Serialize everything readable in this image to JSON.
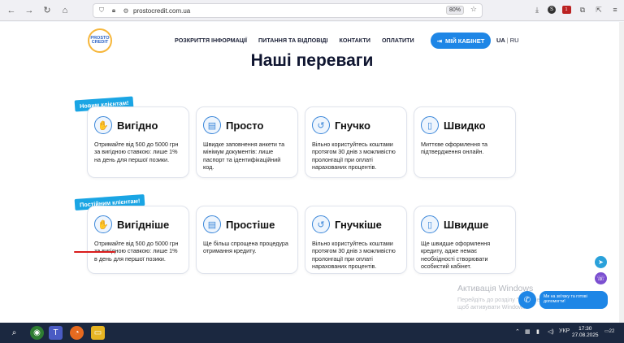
{
  "browser": {
    "url": "prostocredit.com.ua",
    "zoom": "80%",
    "badge_count": "1"
  },
  "header": {
    "logo_line1": "PROSTO",
    "logo_line2": "CREDIT",
    "menu": [
      {
        "label": "РОЗКРИТТЯ ІНФОРМАЦІЇ"
      },
      {
        "label": "ПИТАННЯ ТА ВІДПОВІДІ"
      },
      {
        "label": "КОНТАКТИ"
      },
      {
        "label": "ОПЛАТИТИ"
      }
    ],
    "cabinet_label": "МІЙ КАБІНЕТ",
    "lang_active": "UA",
    "lang_sep": "|",
    "lang_other": "RU"
  },
  "section": {
    "title": "Наші переваги"
  },
  "ribbons": {
    "new_clients": "Новим клієнтам!",
    "regular_clients": "Постійним клієнтам!"
  },
  "row1": [
    {
      "title": "Вигідно",
      "icon": "hand-coin-icon",
      "desc": "Отримайте від 500 до 5000 грн за вигідною ставкою: лише 1% на день для першої позики."
    },
    {
      "title": "Просто",
      "icon": "document-icon",
      "desc": "Швидке заповнення анкети та мінімум документів: лише паспорт та ідентифікаційний код."
    },
    {
      "title": "Гнучко",
      "icon": "refresh-money-icon",
      "desc": "Вільно користуйтесь коштами протягом 30 днів з можливістю пролонгації при оплаті нарахованих процентів."
    },
    {
      "title": "Швидко",
      "icon": "phone-icon",
      "desc": "Миттєве оформлення та підтвердження онлайн."
    }
  ],
  "row2": [
    {
      "title": "Вигідніше",
      "icon": "hand-coin-icon",
      "desc": "Отримайте від 500 до 5000 грн за вигідною ставкою: лише 1% в день для першої позики."
    },
    {
      "title": "Простіше",
      "icon": "document-icon",
      "desc": "Ще більш спрощена процедура отримання кредиту."
    },
    {
      "title": "Гнучкіше",
      "icon": "refresh-money-icon",
      "desc": "Вільно користуйтесь коштами протягом 30 днів з можливістю пролонгації при оплаті нарахованих процентів."
    },
    {
      "title": "Швидше",
      "icon": "phone-icon",
      "desc": "Ще швидше оформлення кредиту, адже немає необхідності створювати особистий кабінет."
    }
  ],
  "watermark": {
    "title": "Активація Windows",
    "text": "Перейдіть до розділу \"Параметри\", щоб активувати Windows."
  },
  "chat": {
    "text": "Ми на зв'язку та готові допомогти!"
  },
  "taskbar": {
    "lang": "УКР",
    "time": "17:30",
    "date": "27.08.2025",
    "notif_count": "22"
  },
  "colors": {
    "accent": "#1e86e6",
    "ribbon": "#1aa5e4",
    "underline": "#d91c1c"
  }
}
